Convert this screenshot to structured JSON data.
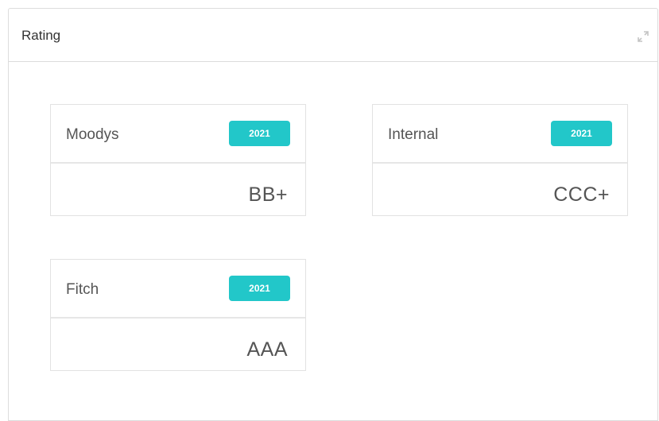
{
  "panel": {
    "title": "Rating",
    "expand_icon": "expand-arrows-icon"
  },
  "ratings": [
    {
      "agency": "Moodys",
      "year": "2021",
      "value": "BB+"
    },
    {
      "agency": "Internal",
      "year": "2021",
      "value": "CCC+"
    },
    {
      "agency": "Fitch",
      "year": "2021",
      "value": "AAA"
    }
  ],
  "colors": {
    "badge": "#22c7c9",
    "border": "#dcdcdc",
    "text": "#555555"
  }
}
